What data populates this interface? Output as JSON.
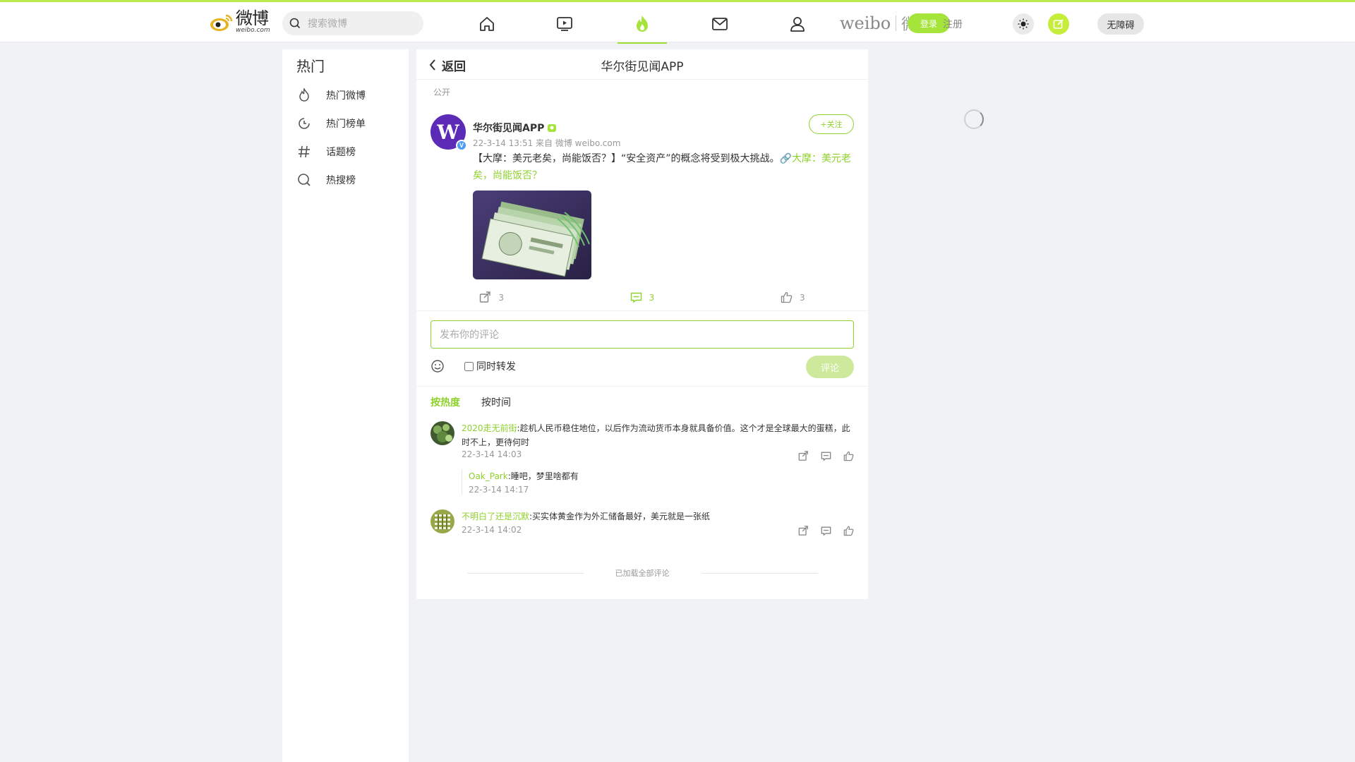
{
  "header": {
    "logo_cn": "微博",
    "logo_en": "weibo.com",
    "search_placeholder": "搜索微博",
    "nav": [
      "home",
      "video",
      "hot",
      "messages",
      "profile"
    ],
    "weibo_mark_en": "weibo",
    "weibo_mark_cn": "微博",
    "login_label": "登录",
    "register_label": "注册",
    "accessibility_label": "无障碍",
    "accent_color": "#9cde31"
  },
  "sidebar": {
    "title": "热门",
    "items": [
      {
        "label": "热门微博",
        "icon": "flame-icon"
      },
      {
        "label": "热门榜单",
        "icon": "clock-rank-icon"
      },
      {
        "label": "话题榜",
        "icon": "hashtag-icon"
      },
      {
        "label": "热搜榜",
        "icon": "search-rank-icon"
      }
    ]
  },
  "detail": {
    "back_label": "返回",
    "title": "华尔街见闻APP",
    "visibility": "公开"
  },
  "post": {
    "author": "华尔街见闻APP",
    "meta": "22-3-14 13:51  来自 微博 weibo.com",
    "follow_label": "+关注",
    "text": "【大摩：美元老矣，尚能饭否？】“安全资产”的概念将受到极大挑战。",
    "link_text": "🔗大摩：美元老矣，尚能饭否？",
    "repost_count": "3",
    "comment_count": "3",
    "like_count": "3"
  },
  "composer": {
    "placeholder": "发布你的评论",
    "repost_label": "同时转发",
    "submit_label": "评论"
  },
  "sort": {
    "hot_label": "按热度",
    "time_label": "按时间"
  },
  "comments": [
    {
      "user": "2020走无前街",
      "text": ":趁机人民币稳住地位，以后作为流动货币本身就具备价值。这个才是全球最大的蛋糕，此时不上，更待何时",
      "time": "22-3-14 14:03",
      "reply": {
        "user": "Oak_Park",
        "text": ":睡吧，梦里啥都有",
        "time": "22-3-14 14:17"
      }
    },
    {
      "user": "不明白了还是沉默",
      "text": ":买实体黄金作为外汇储备最好，美元就是一张纸",
      "time": "22-3-14 14:02"
    }
  ],
  "footer_note": "已加载全部评论"
}
